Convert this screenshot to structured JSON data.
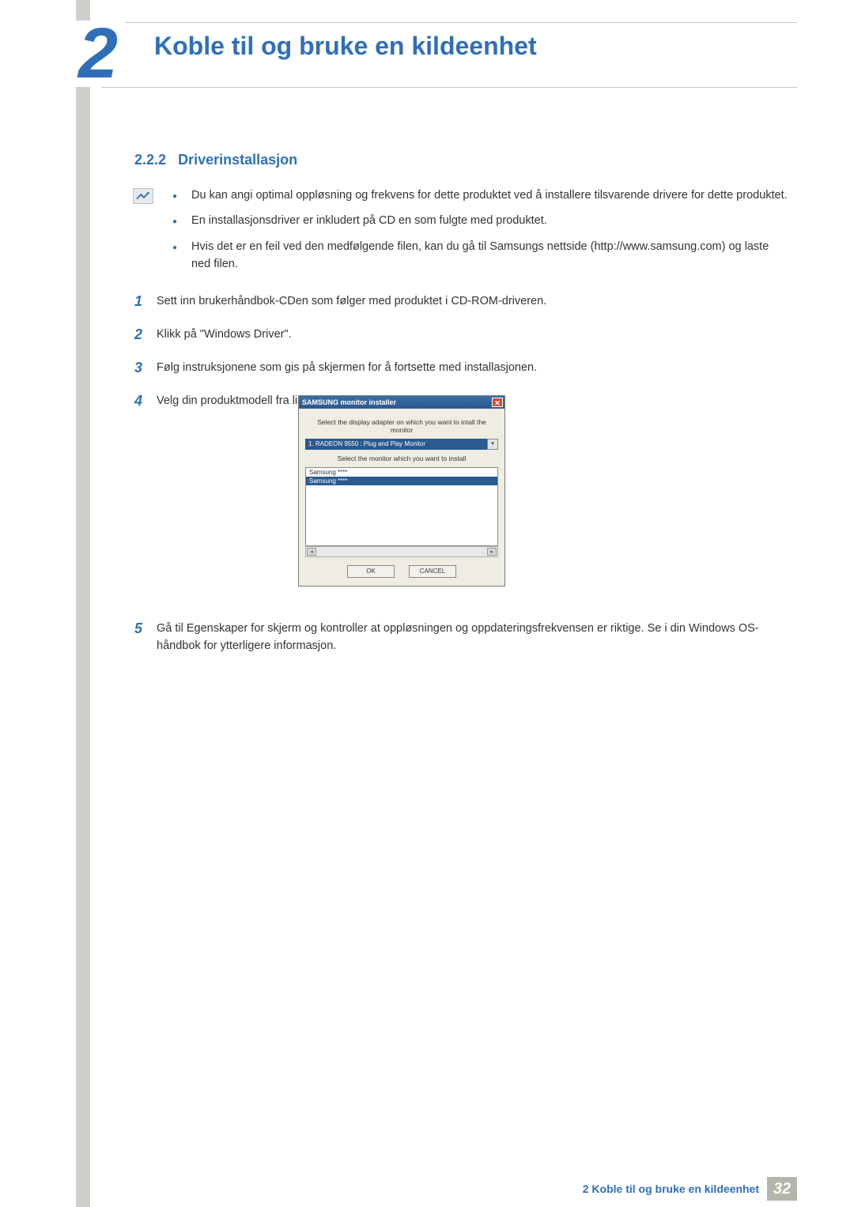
{
  "chapter": {
    "number": "2",
    "title": "Koble til og bruke en kildeenhet"
  },
  "section": {
    "number": "2.2.2",
    "title": "Driverinstallasjon"
  },
  "notes": [
    "Du kan angi optimal oppløsning og frekvens for dette produktet ved å installere tilsvarende drivere for dette produktet.",
    "En installasjonsdriver er inkludert på CD en som fulgte med produktet.",
    "Hvis det er en feil ved den medfølgende filen, kan du gå til Samsungs nettside (http://www.samsung.com) og laste ned filen."
  ],
  "steps_before": [
    {
      "num": "1",
      "text": "Sett inn brukerhåndbok-CDen som følger med produktet i CD-ROM-driveren."
    },
    {
      "num": "2",
      "text": "Klikk på \"Windows Driver\"."
    },
    {
      "num": "3",
      "text": "Følg instruksjonene som gis på skjermen for å fortsette med installasjonen."
    },
    {
      "num": "4",
      "text": "Velg din produktmodell fra listen over modeller."
    }
  ],
  "steps_after": [
    {
      "num": "5",
      "text": "Gå til Egenskaper for skjerm og kontroller at oppløsningen og oppdateringsfrekvensen er riktige. Se i din Windows OS-håndbok for ytterligere informasjon."
    }
  ],
  "installer": {
    "title": "SAMSUNG monitor installer",
    "label_adapter": "Select the display adapter on which you want to intall the monitor",
    "adapter_value": "1. RADEON 9550 : Plug and Play Monitor",
    "label_monitor": "Select the monitor which you want to install",
    "list": [
      "Samsung ****",
      "Samsung ****"
    ],
    "ok": "OK",
    "cancel": "CANCEL"
  },
  "footer": {
    "text": "2 Koble til og bruke en kildeenhet",
    "page": "32"
  }
}
